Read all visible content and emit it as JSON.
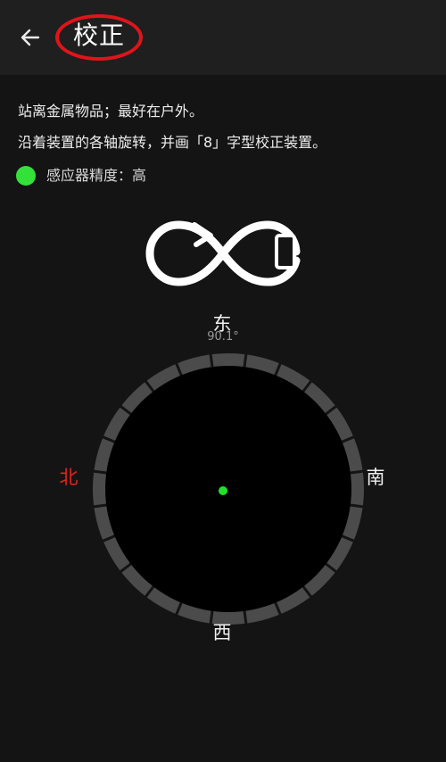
{
  "header": {
    "title": "校正"
  },
  "instructions": {
    "line1": "站离金属物品；最好在户外。",
    "line2": "沿着装置的各轴旋转，并画「8」字型校正装置。"
  },
  "accuracy": {
    "label": "感应器精度：",
    "value": "高",
    "indicator_color": "#33e13a"
  },
  "heading": {
    "readout": "90.1°",
    "degrees": 90.1
  },
  "compass": {
    "north": "北",
    "east": "东",
    "south": "南",
    "west": "西",
    "north_color": "#e2241f",
    "center_dot_color": "#22e02a"
  },
  "icons": {
    "back": "back-arrow-icon",
    "calibration": "figure-eight-phone-icon"
  }
}
